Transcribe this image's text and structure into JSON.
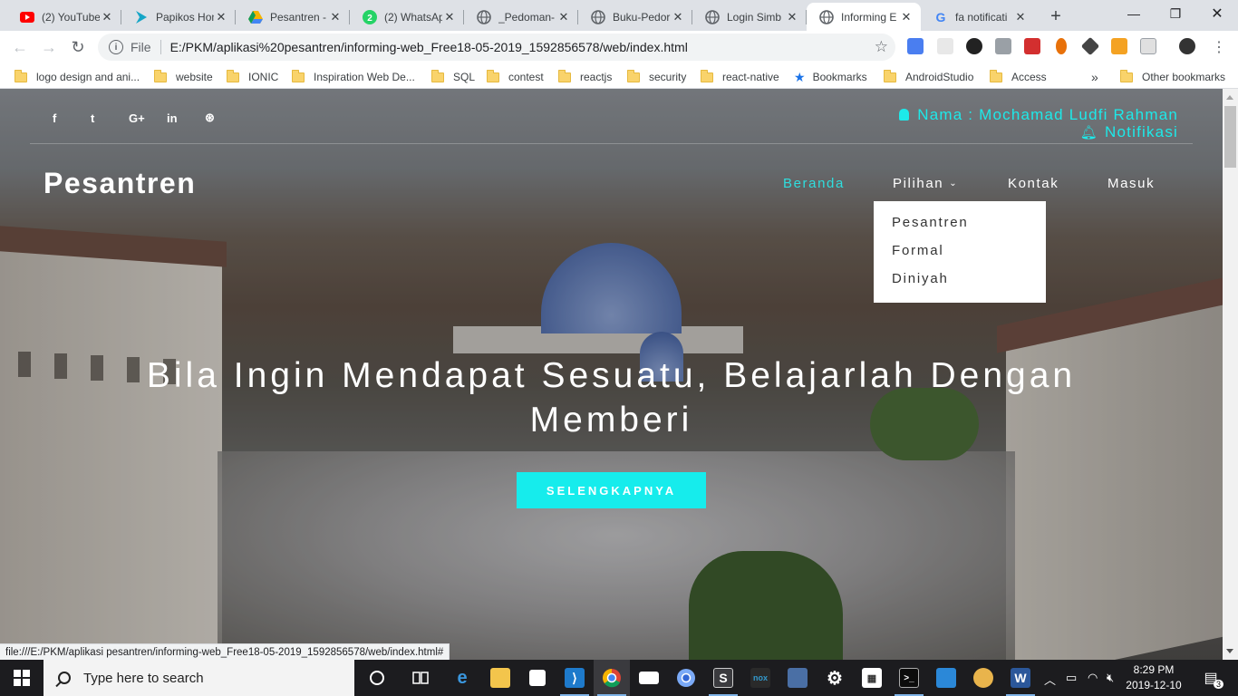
{
  "browser": {
    "tabs": [
      {
        "title": "(2) YouTube",
        "icon": "youtube-icon",
        "color": "#ff0000"
      },
      {
        "title": "Papikos Hom",
        "icon": "papikos-icon",
        "color": "#16a6c7"
      },
      {
        "title": "Pesantren -",
        "icon": "google-drive-icon",
        "color": "#f4b400"
      },
      {
        "title": "(2) WhatsAp",
        "icon": "whatsapp-icon",
        "color": "#25d366"
      },
      {
        "title": "_Pedoman-",
        "icon": "globe-icon",
        "color": "#5f6368"
      },
      {
        "title": "Buku-Pedor",
        "icon": "globe-icon",
        "color": "#5f6368"
      },
      {
        "title": "Login Simb",
        "icon": "globe-icon",
        "color": "#5f6368"
      },
      {
        "title": "Informing E",
        "icon": "globe-icon",
        "color": "#5f6368",
        "active": true
      },
      {
        "title": "fa notificati",
        "icon": "google-icon",
        "color": "#4285f4"
      }
    ],
    "url_scheme": "File",
    "url": "E:/PKM/aplikasi%20pesantren/informing-web_Free18-05-2019_1592856578/web/index.html",
    "bookmarks": [
      {
        "label": "logo design and ani...",
        "type": "folder"
      },
      {
        "label": "website",
        "type": "folder"
      },
      {
        "label": "IONIC",
        "type": "folder"
      },
      {
        "label": "Inspiration Web De...",
        "type": "folder"
      },
      {
        "label": "SQL",
        "type": "folder"
      },
      {
        "label": "contest",
        "type": "folder"
      },
      {
        "label": "reactjs",
        "type": "folder"
      },
      {
        "label": "security",
        "type": "folder"
      },
      {
        "label": "react-native",
        "type": "folder"
      },
      {
        "label": "Bookmarks",
        "type": "star"
      },
      {
        "label": "AndroidStudio",
        "type": "folder"
      },
      {
        "label": "Access",
        "type": "folder"
      },
      {
        "label": "Other bookmarks",
        "type": "folder"
      }
    ],
    "bookmarks_overflow": "»",
    "status_url": "file:///E:/PKM/aplikasi pesantren/informing-web_Free18-05-2019_1592856578/web/index.html#"
  },
  "page": {
    "social": [
      {
        "label": "f",
        "icon": "facebook-icon"
      },
      {
        "label": "t",
        "icon": "twitter-icon"
      },
      {
        "label": "G+",
        "icon": "google-plus-icon"
      },
      {
        "label": "in",
        "icon": "linkedin-icon"
      },
      {
        "label": "⊛",
        "icon": "dribbble-icon"
      }
    ],
    "user_label": "Nama : Mochamad Ludfi Rahman",
    "notif_label": "Notifikasi",
    "brand": "Pesantren",
    "nav": {
      "beranda": "Beranda",
      "pilihan": "Pilihan",
      "kontak": "Kontak",
      "masuk": "Masuk"
    },
    "dropdown": [
      "Pesantren",
      "Formal",
      "Diniyah"
    ],
    "headline_line1": "Bila Ingin Mendapat Sesuatu, Belajarlah Dengan",
    "headline_line2": "Memberi",
    "cta": "SELENGKAPNYA",
    "accent": "#16ecec"
  },
  "taskbar": {
    "search_placeholder": "Type here to search",
    "time": "8:29 PM",
    "date": "2019-12-10",
    "notification_count": "3"
  }
}
